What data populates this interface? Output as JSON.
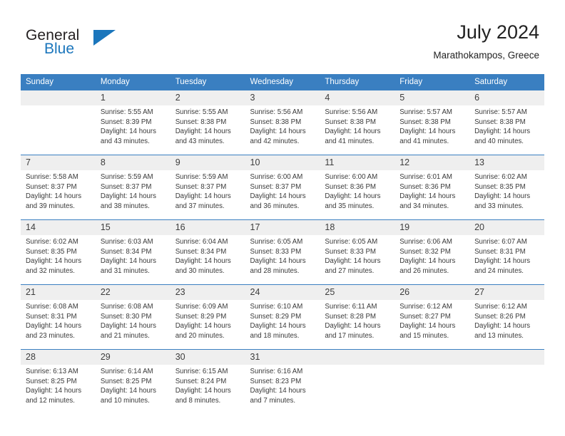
{
  "brand": {
    "word_general": "General",
    "word_blue": "Blue",
    "flag_color": "#1b76bc"
  },
  "header": {
    "month_title": "July 2024",
    "location": "Marathokampos, Greece"
  },
  "theme": {
    "header_row_bg": "#3a7fc1",
    "daynum_bg": "#efefef",
    "text_color": "#3a3a3a"
  },
  "calendar": {
    "weekday_headers": [
      "Sunday",
      "Monday",
      "Tuesday",
      "Wednesday",
      "Thursday",
      "Friday",
      "Saturday"
    ],
    "weeks": [
      [
        {
          "day": "",
          "sunrise": "",
          "sunset": "",
          "daylight_line1": "",
          "daylight_line2": ""
        },
        {
          "day": "1",
          "sunrise": "Sunrise: 5:55 AM",
          "sunset": "Sunset: 8:39 PM",
          "daylight_line1": "Daylight: 14 hours",
          "daylight_line2": "and 43 minutes."
        },
        {
          "day": "2",
          "sunrise": "Sunrise: 5:55 AM",
          "sunset": "Sunset: 8:38 PM",
          "daylight_line1": "Daylight: 14 hours",
          "daylight_line2": "and 43 minutes."
        },
        {
          "day": "3",
          "sunrise": "Sunrise: 5:56 AM",
          "sunset": "Sunset: 8:38 PM",
          "daylight_line1": "Daylight: 14 hours",
          "daylight_line2": "and 42 minutes."
        },
        {
          "day": "4",
          "sunrise": "Sunrise: 5:56 AM",
          "sunset": "Sunset: 8:38 PM",
          "daylight_line1": "Daylight: 14 hours",
          "daylight_line2": "and 41 minutes."
        },
        {
          "day": "5",
          "sunrise": "Sunrise: 5:57 AM",
          "sunset": "Sunset: 8:38 PM",
          "daylight_line1": "Daylight: 14 hours",
          "daylight_line2": "and 41 minutes."
        },
        {
          "day": "6",
          "sunrise": "Sunrise: 5:57 AM",
          "sunset": "Sunset: 8:38 PM",
          "daylight_line1": "Daylight: 14 hours",
          "daylight_line2": "and 40 minutes."
        }
      ],
      [
        {
          "day": "7",
          "sunrise": "Sunrise: 5:58 AM",
          "sunset": "Sunset: 8:37 PM",
          "daylight_line1": "Daylight: 14 hours",
          "daylight_line2": "and 39 minutes."
        },
        {
          "day": "8",
          "sunrise": "Sunrise: 5:59 AM",
          "sunset": "Sunset: 8:37 PM",
          "daylight_line1": "Daylight: 14 hours",
          "daylight_line2": "and 38 minutes."
        },
        {
          "day": "9",
          "sunrise": "Sunrise: 5:59 AM",
          "sunset": "Sunset: 8:37 PM",
          "daylight_line1": "Daylight: 14 hours",
          "daylight_line2": "and 37 minutes."
        },
        {
          "day": "10",
          "sunrise": "Sunrise: 6:00 AM",
          "sunset": "Sunset: 8:37 PM",
          "daylight_line1": "Daylight: 14 hours",
          "daylight_line2": "and 36 minutes."
        },
        {
          "day": "11",
          "sunrise": "Sunrise: 6:00 AM",
          "sunset": "Sunset: 8:36 PM",
          "daylight_line1": "Daylight: 14 hours",
          "daylight_line2": "and 35 minutes."
        },
        {
          "day": "12",
          "sunrise": "Sunrise: 6:01 AM",
          "sunset": "Sunset: 8:36 PM",
          "daylight_line1": "Daylight: 14 hours",
          "daylight_line2": "and 34 minutes."
        },
        {
          "day": "13",
          "sunrise": "Sunrise: 6:02 AM",
          "sunset": "Sunset: 8:35 PM",
          "daylight_line1": "Daylight: 14 hours",
          "daylight_line2": "and 33 minutes."
        }
      ],
      [
        {
          "day": "14",
          "sunrise": "Sunrise: 6:02 AM",
          "sunset": "Sunset: 8:35 PM",
          "daylight_line1": "Daylight: 14 hours",
          "daylight_line2": "and 32 minutes."
        },
        {
          "day": "15",
          "sunrise": "Sunrise: 6:03 AM",
          "sunset": "Sunset: 8:34 PM",
          "daylight_line1": "Daylight: 14 hours",
          "daylight_line2": "and 31 minutes."
        },
        {
          "day": "16",
          "sunrise": "Sunrise: 6:04 AM",
          "sunset": "Sunset: 8:34 PM",
          "daylight_line1": "Daylight: 14 hours",
          "daylight_line2": "and 30 minutes."
        },
        {
          "day": "17",
          "sunrise": "Sunrise: 6:05 AM",
          "sunset": "Sunset: 8:33 PM",
          "daylight_line1": "Daylight: 14 hours",
          "daylight_line2": "and 28 minutes."
        },
        {
          "day": "18",
          "sunrise": "Sunrise: 6:05 AM",
          "sunset": "Sunset: 8:33 PM",
          "daylight_line1": "Daylight: 14 hours",
          "daylight_line2": "and 27 minutes."
        },
        {
          "day": "19",
          "sunrise": "Sunrise: 6:06 AM",
          "sunset": "Sunset: 8:32 PM",
          "daylight_line1": "Daylight: 14 hours",
          "daylight_line2": "and 26 minutes."
        },
        {
          "day": "20",
          "sunrise": "Sunrise: 6:07 AM",
          "sunset": "Sunset: 8:31 PM",
          "daylight_line1": "Daylight: 14 hours",
          "daylight_line2": "and 24 minutes."
        }
      ],
      [
        {
          "day": "21",
          "sunrise": "Sunrise: 6:08 AM",
          "sunset": "Sunset: 8:31 PM",
          "daylight_line1": "Daylight: 14 hours",
          "daylight_line2": "and 23 minutes."
        },
        {
          "day": "22",
          "sunrise": "Sunrise: 6:08 AM",
          "sunset": "Sunset: 8:30 PM",
          "daylight_line1": "Daylight: 14 hours",
          "daylight_line2": "and 21 minutes."
        },
        {
          "day": "23",
          "sunrise": "Sunrise: 6:09 AM",
          "sunset": "Sunset: 8:29 PM",
          "daylight_line1": "Daylight: 14 hours",
          "daylight_line2": "and 20 minutes."
        },
        {
          "day": "24",
          "sunrise": "Sunrise: 6:10 AM",
          "sunset": "Sunset: 8:29 PM",
          "daylight_line1": "Daylight: 14 hours",
          "daylight_line2": "and 18 minutes."
        },
        {
          "day": "25",
          "sunrise": "Sunrise: 6:11 AM",
          "sunset": "Sunset: 8:28 PM",
          "daylight_line1": "Daylight: 14 hours",
          "daylight_line2": "and 17 minutes."
        },
        {
          "day": "26",
          "sunrise": "Sunrise: 6:12 AM",
          "sunset": "Sunset: 8:27 PM",
          "daylight_line1": "Daylight: 14 hours",
          "daylight_line2": "and 15 minutes."
        },
        {
          "day": "27",
          "sunrise": "Sunrise: 6:12 AM",
          "sunset": "Sunset: 8:26 PM",
          "daylight_line1": "Daylight: 14 hours",
          "daylight_line2": "and 13 minutes."
        }
      ],
      [
        {
          "day": "28",
          "sunrise": "Sunrise: 6:13 AM",
          "sunset": "Sunset: 8:25 PM",
          "daylight_line1": "Daylight: 14 hours",
          "daylight_line2": "and 12 minutes."
        },
        {
          "day": "29",
          "sunrise": "Sunrise: 6:14 AM",
          "sunset": "Sunset: 8:25 PM",
          "daylight_line1": "Daylight: 14 hours",
          "daylight_line2": "and 10 minutes."
        },
        {
          "day": "30",
          "sunrise": "Sunrise: 6:15 AM",
          "sunset": "Sunset: 8:24 PM",
          "daylight_line1": "Daylight: 14 hours",
          "daylight_line2": "and 8 minutes."
        },
        {
          "day": "31",
          "sunrise": "Sunrise: 6:16 AM",
          "sunset": "Sunset: 8:23 PM",
          "daylight_line1": "Daylight: 14 hours",
          "daylight_line2": "and 7 minutes."
        },
        {
          "day": "",
          "sunrise": "",
          "sunset": "",
          "daylight_line1": "",
          "daylight_line2": ""
        },
        {
          "day": "",
          "sunrise": "",
          "sunset": "",
          "daylight_line1": "",
          "daylight_line2": ""
        },
        {
          "day": "",
          "sunrise": "",
          "sunset": "",
          "daylight_line1": "",
          "daylight_line2": ""
        }
      ]
    ]
  }
}
